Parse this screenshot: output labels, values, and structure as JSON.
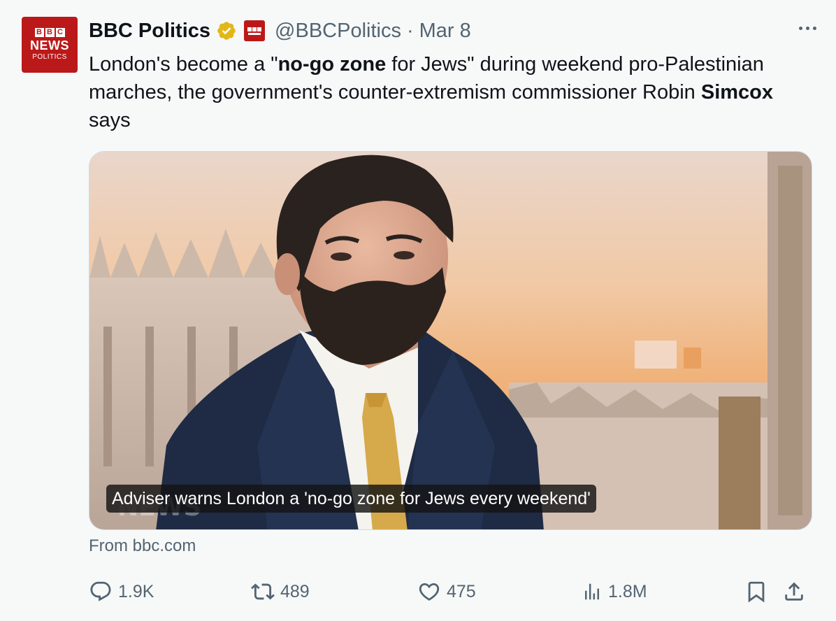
{
  "account": {
    "display_name": "BBC Politics",
    "handle": "@BBCPolitics",
    "separator": "·",
    "date": "Mar 8",
    "verified_color": "#e2b719",
    "brand_color": "#bb1919",
    "avatar": {
      "blocks": [
        "B",
        "B",
        "C"
      ],
      "line1": "NEWS",
      "line2": "POLITICS"
    }
  },
  "tweet": {
    "text_parts": [
      "London's become a \"",
      "no-go zone",
      " for Jews\" during weekend pro-Palestinian marches, the government's counter-extremism commissioner Robin ",
      "Simcox",
      " says"
    ]
  },
  "media": {
    "caption": "Adviser warns London a 'no-go zone for Jews every weekend'",
    "source": "From bbc.com"
  },
  "actions": {
    "replies": "1.9K",
    "reposts": "489",
    "likes": "475",
    "views": "1.8M"
  },
  "icons": {
    "verified": "verified-badge-icon",
    "affiliate": "bbc-affiliate-icon",
    "more": "more-icon",
    "reply": "reply-icon",
    "repost": "repost-icon",
    "like": "heart-icon",
    "views": "views-icon",
    "bookmark": "bookmark-icon",
    "share": "share-icon"
  }
}
